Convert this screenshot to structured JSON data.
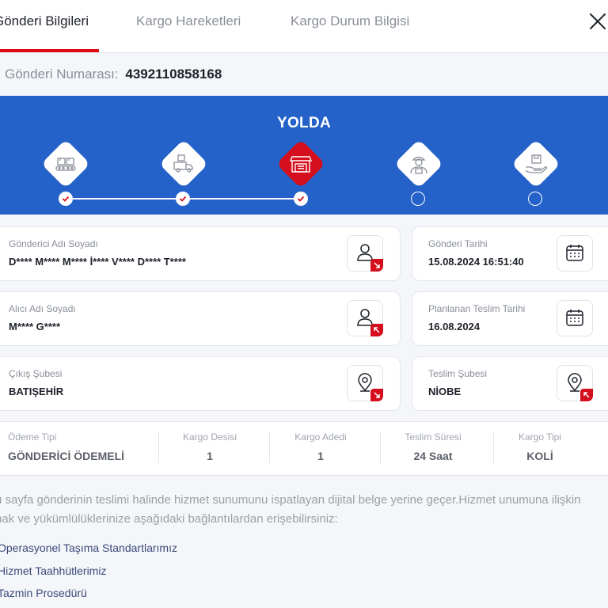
{
  "tabs": [
    {
      "label": "Gönderi Bilgileri",
      "active": true
    },
    {
      "label": "Kargo Hareketleri",
      "active": false
    },
    {
      "label": "Kargo Durum Bilgisi",
      "active": false
    }
  ],
  "tracking": {
    "label": "Gönderi Numarası:",
    "number": "4392110858168"
  },
  "status": {
    "title": "YOLDA",
    "steps": [
      {
        "icon": "conveyor-boxes-icon",
        "done": true
      },
      {
        "icon": "delivery-truck-icon",
        "done": true
      },
      {
        "icon": "branch-store-icon",
        "done": true,
        "current": true
      },
      {
        "icon": "courier-icon",
        "done": false
      },
      {
        "icon": "hand-package-icon",
        "done": false
      }
    ]
  },
  "details": {
    "sender": {
      "label": "Gönderici Adı Soyadı",
      "value": "D**** M**** M**** İ**** V**** D**** T****"
    },
    "receiver": {
      "label": "Alıcı Adı Soyadı",
      "value": "M**** G****"
    },
    "origin_branch": {
      "label": "Çıkış Şubesi",
      "value": "BATIŞEHİR"
    },
    "ship_date": {
      "label": "Gönderi Tarihi",
      "value": "15.08.2024 16:51:40"
    },
    "planned_delivery": {
      "label": "Planlanan Teslim Tarihi",
      "value": "16.08.2024"
    },
    "delivery_branch": {
      "label": "Teslim Şubesi",
      "value": "NİOBE"
    }
  },
  "summary": [
    {
      "label": "Ödeme Tipi",
      "value": "GÖNDERİCİ ÖDEMELİ"
    },
    {
      "label": "Kargo Desisi",
      "value": "1"
    },
    {
      "label": "Kargo Adedi",
      "value": "1"
    },
    {
      "label": "Teslim Süresi",
      "value": "24 Saat"
    },
    {
      "label": "Kargo Tipi",
      "value": "KOLİ"
    }
  ],
  "info_text": "u sayfa gönderinin teslimi halinde hizmet sunumunu ispatlayan dijital belge yerine geçer.Hizmet unumuna ilişkin hak ve yükümlülüklerinize aşağıdaki bağlantılardan erişebilirsiniz:",
  "links": [
    "Operasyonel Taşıma Standartlarımız",
    "Hizmet Taahhütlerimiz",
    "Tazmin Prosedürü"
  ],
  "colors": {
    "brand_blue": "#2462c9",
    "brand_red": "#d40e1c"
  }
}
